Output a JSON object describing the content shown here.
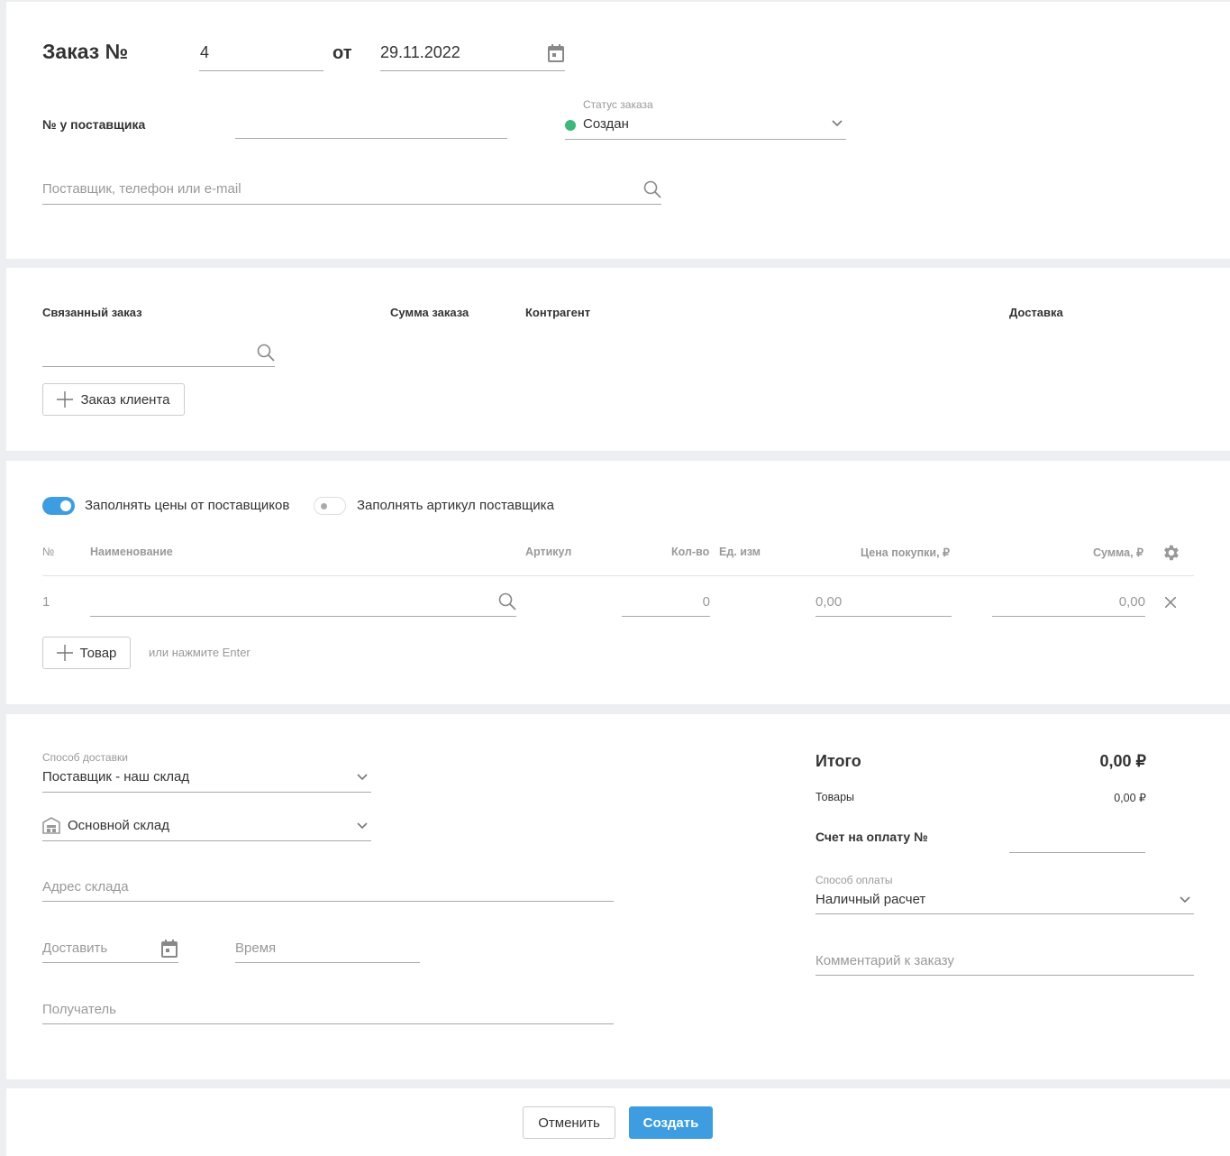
{
  "header": {
    "title": "Заказ №",
    "order_number": "4",
    "from_label": "от",
    "date": "29.11.2022",
    "supplier_no_label": "№ у поставщика",
    "supplier_no_value": "",
    "status_label": "Статус заказа",
    "status_value": "Создан",
    "status_color": "#3cb878",
    "supplier_search_placeholder": "Поставщик, телефон или e-mail"
  },
  "linked": {
    "col_linked": "Связанный заказ",
    "col_sum": "Сумма заказа",
    "col_counterparty": "Контрагент",
    "col_delivery": "Доставка",
    "add_client_order": "Заказ клиента"
  },
  "items": {
    "toggle_prices_label": "Заполнять цены от поставщиков",
    "toggle_prices_on": true,
    "toggle_article_label": "Заполнять артикул поставщика",
    "toggle_article_on": false,
    "columns": {
      "no": "№",
      "name": "Наименование",
      "article": "Артикул",
      "qty": "Кол-во",
      "unit": "Ед. изм",
      "price": "Цена покупки, ₽",
      "sum": "Сумма, ₽"
    },
    "rows": [
      {
        "no": "1",
        "name": "",
        "qty": "0",
        "price": "0,00",
        "sum": "0,00"
      }
    ],
    "add_item": "Товар",
    "hint": "или нажмите Enter"
  },
  "delivery": {
    "method_label": "Способ доставки",
    "method_value": "Поставщик - наш склад",
    "warehouse_value": "Основной склад",
    "address_placeholder": "Адрес склада",
    "deliver_placeholder": "Доставить",
    "time_placeholder": "Время",
    "recipient_placeholder": "Получатель"
  },
  "totals": {
    "total_label": "Итого",
    "total_value": "0,00 ₽",
    "goods_label": "Товары",
    "goods_value": "0,00 ₽",
    "invoice_label": "Счет на оплату №",
    "payment_label": "Способ оплаты",
    "payment_value": "Наличный расчет",
    "comment_placeholder": "Комментарий к заказу"
  },
  "footer": {
    "cancel": "Отменить",
    "create": "Создать"
  },
  "colors": {
    "accent": "#3d9de0"
  }
}
